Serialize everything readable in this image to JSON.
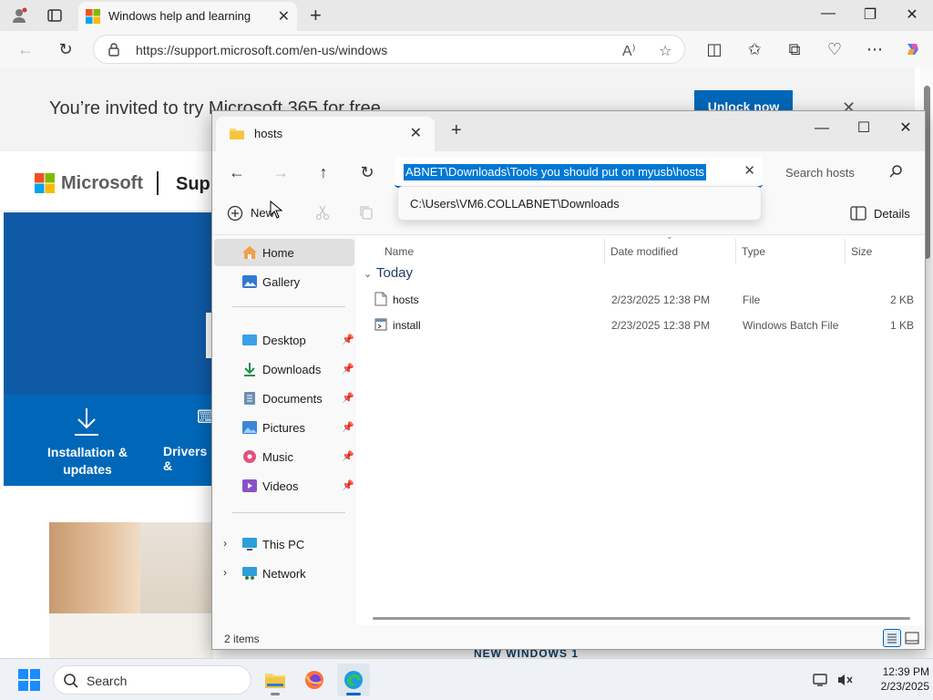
{
  "browser": {
    "tab_title": "Windows help and learning",
    "url": "https://support.microsoft.com/en-us/windows"
  },
  "page": {
    "promo_text": "You’re invited to try Microsoft 365 for free",
    "promo_button": "Unlock now",
    "brand": "Microsoft",
    "section": "Supp",
    "tile1_label": "Installation & updates",
    "tile2_label": "Drivers &",
    "bottom_peek": "NEW WINDOWS 1"
  },
  "explorer": {
    "tab_title": "hosts",
    "address_selected": "ABNET\\Downloads\\Tools you should put on myusb\\hosts",
    "search_placeholder": "Search hosts",
    "suggestion": "C:\\Users\\VM6.COLLABNET\\Downloads",
    "new_label": "New",
    "details_label": "Details",
    "sidebar": {
      "home": "Home",
      "gallery": "Gallery",
      "desktop": "Desktop",
      "downloads": "Downloads",
      "documents": "Documents",
      "pictures": "Pictures",
      "music": "Music",
      "videos": "Videos",
      "this_pc": "This PC",
      "network": "Network"
    },
    "columns": {
      "name": "Name",
      "date": "Date modified",
      "type": "Type",
      "size": "Size"
    },
    "group_label": "Today",
    "files": [
      {
        "name": "hosts",
        "date": "2/23/2025 12:38 PM",
        "type": "File",
        "size": "2 KB"
      },
      {
        "name": "install",
        "date": "2/23/2025 12:38 PM",
        "type": "Windows Batch File",
        "size": "1 KB"
      }
    ],
    "status_text": "2 items"
  },
  "taskbar": {
    "search_text": "Search",
    "time": "12:39 PM",
    "date": "2/23/2025"
  },
  "colors": {
    "accent": "#0067c0",
    "ms_blue": "#0067b8",
    "selection": "#0078d4"
  }
}
